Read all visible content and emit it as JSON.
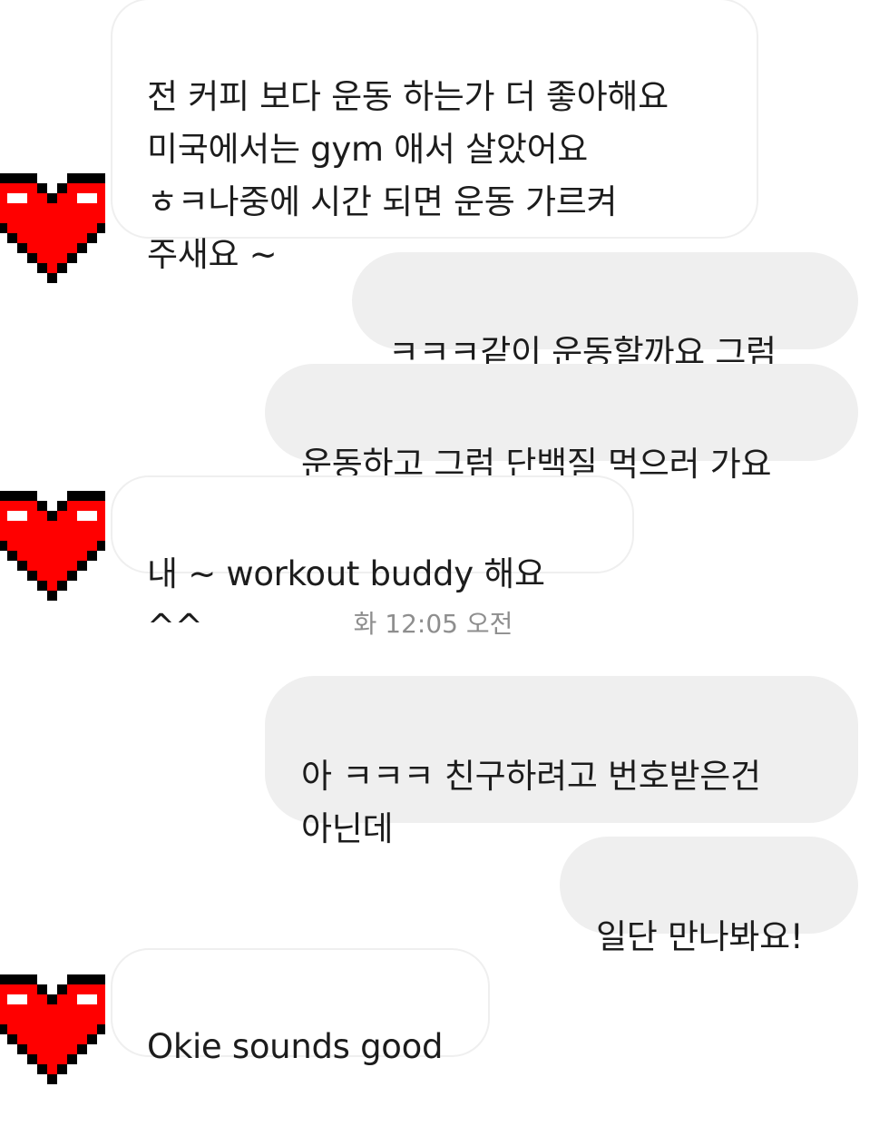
{
  "conversation": {
    "timestamp": "화 12:05 오전",
    "messages": [
      {
        "direction": "in",
        "text": "전 커피 보다 운동 하는가 더 좋아해요\n미국에서는 gym 애서 살았어요\nㅎㅋ나중에 시간 되면 운동 가르켜\n주새요 ~"
      },
      {
        "direction": "out",
        "text": "ㅋㅋㅋ같이 운동할까요 그럼"
      },
      {
        "direction": "out",
        "text": "운동하고 그럼 단백질 먹으러 가요"
      },
      {
        "direction": "in",
        "text": "내 ~ workout buddy 해요 ^^"
      },
      {
        "direction": "out",
        "text": "아 ㅋㅋㅋ 친구하려고 번호받은건\n아닌데"
      },
      {
        "direction": "out",
        "text": "일단 만나봐요!"
      },
      {
        "direction": "in",
        "text": "Okie sounds good"
      }
    ]
  },
  "avatar": {
    "icon": "pixel-heart-icon",
    "colors": {
      "fill": "#ff0000",
      "outline": "#000000",
      "highlight": "#ffffff"
    }
  }
}
